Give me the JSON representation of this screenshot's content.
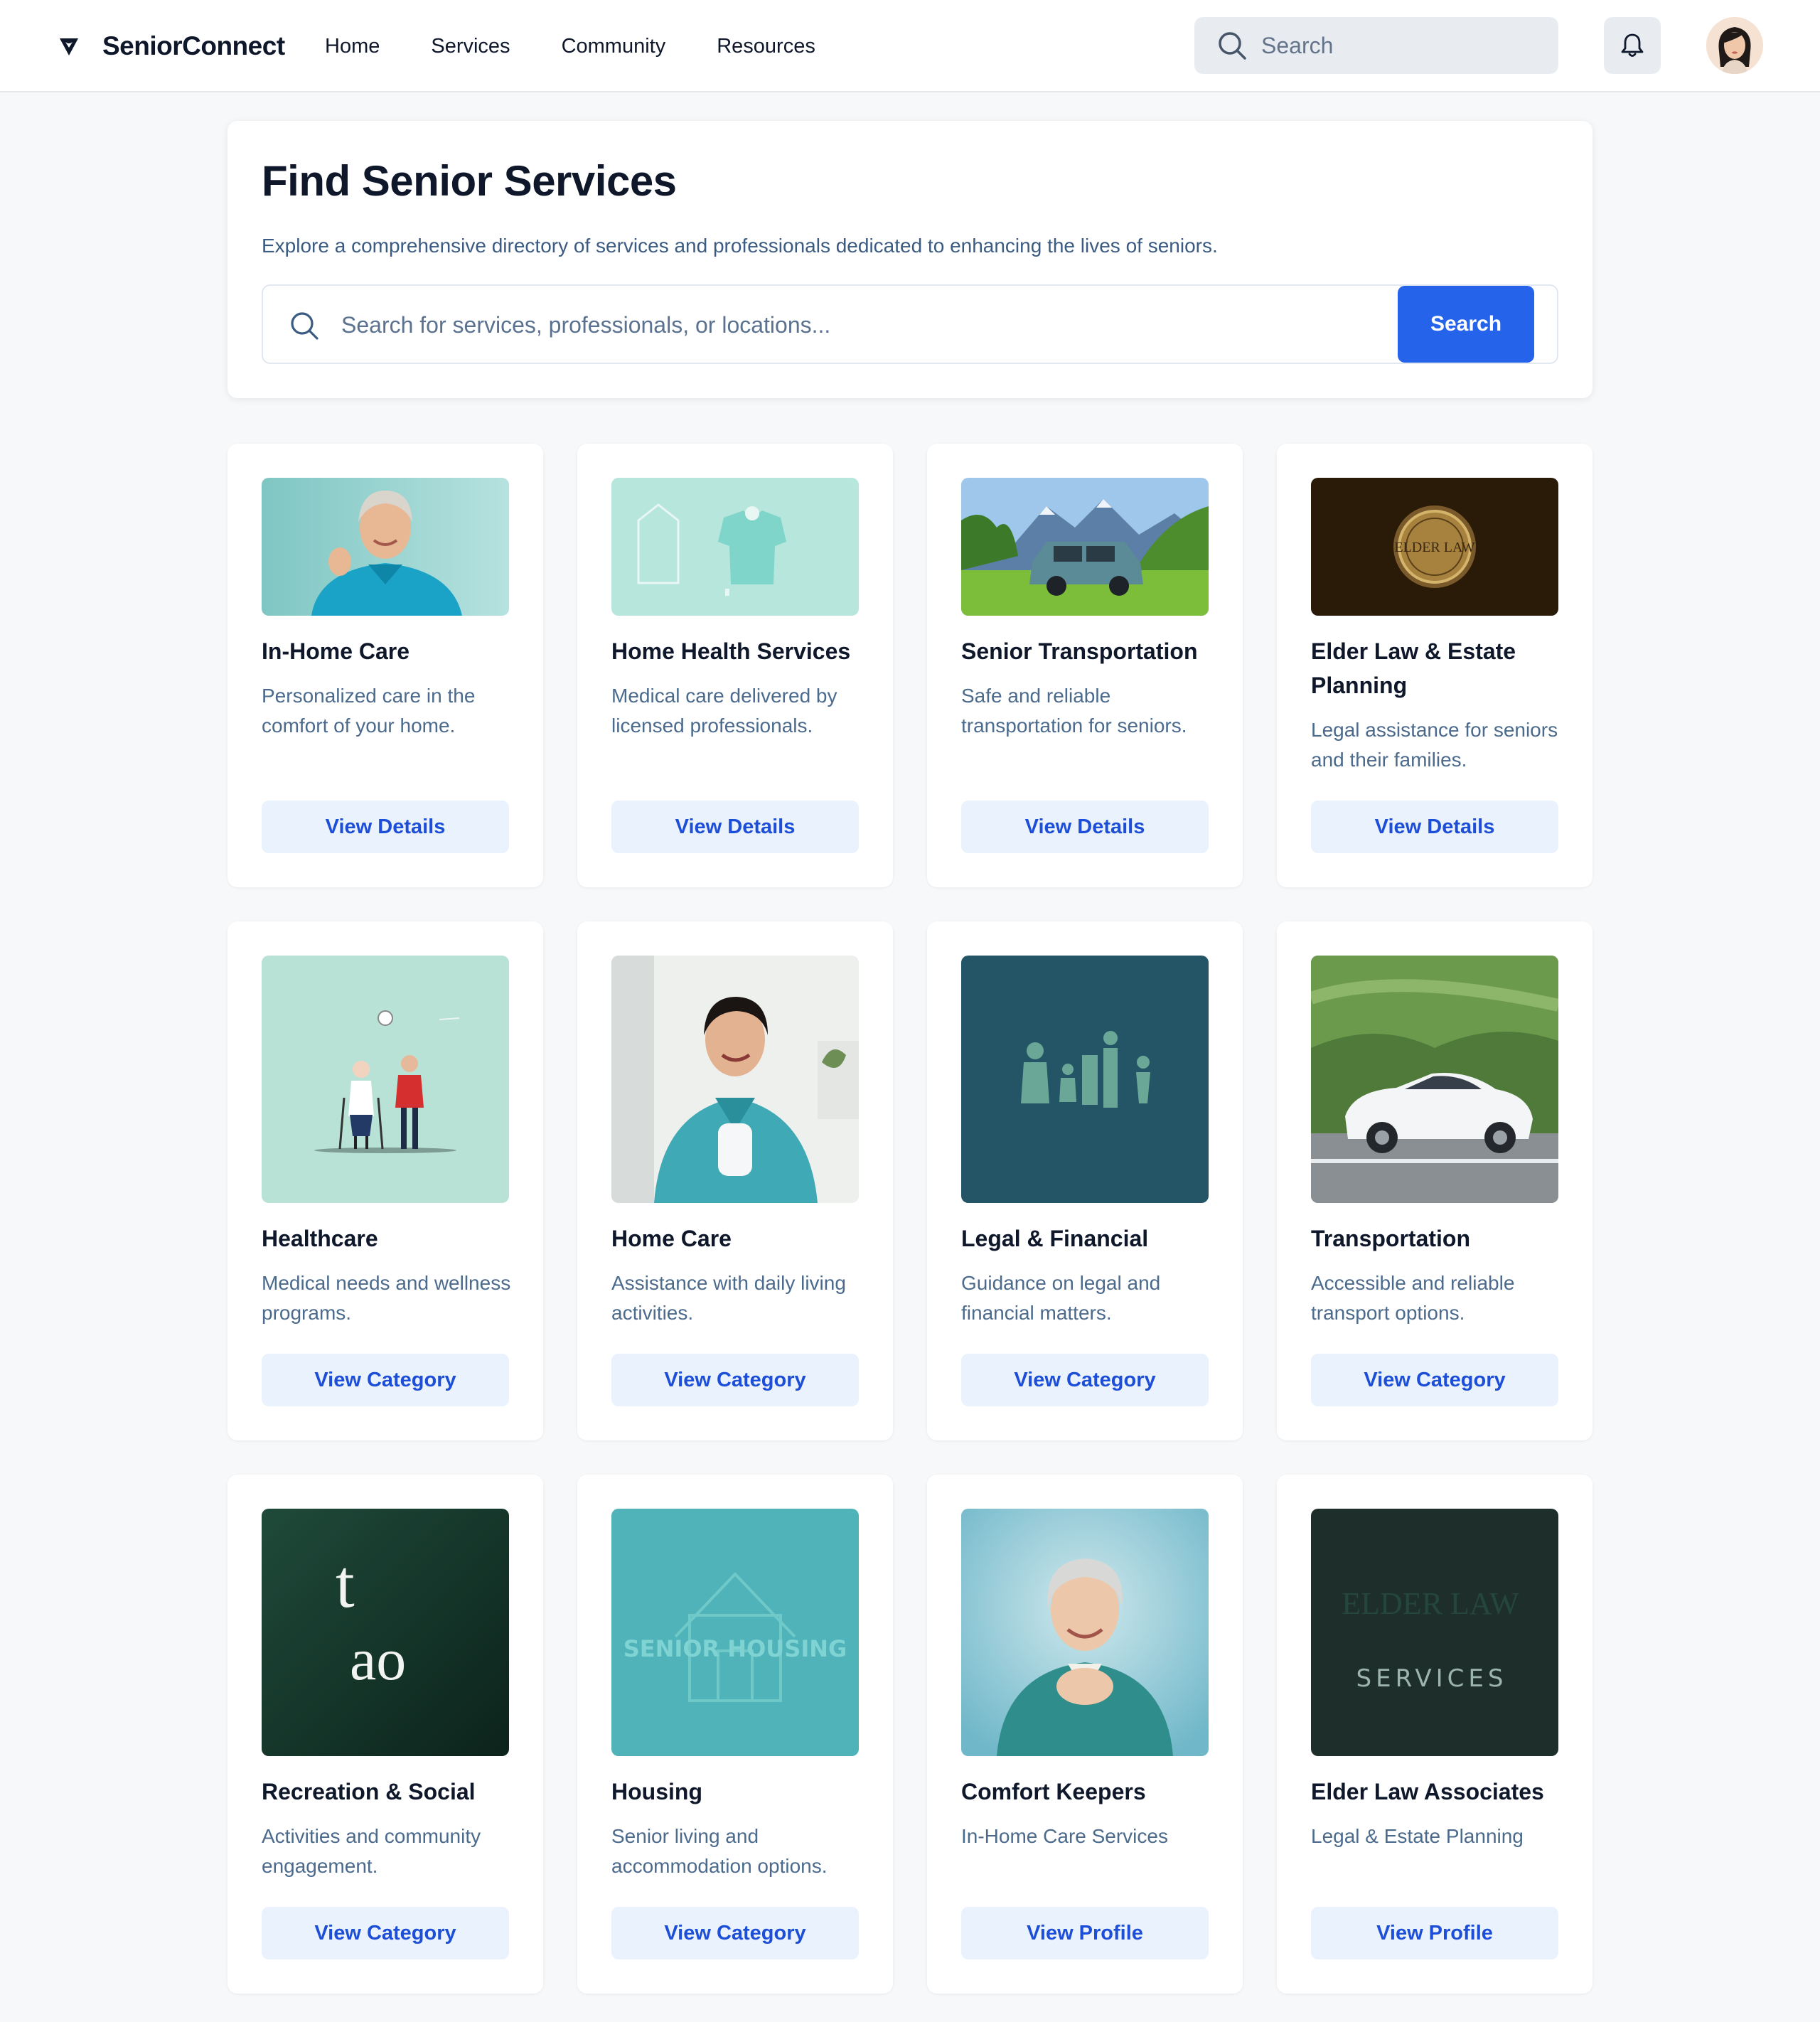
{
  "brand": {
    "name": "SeniorConnect",
    "icon": "shield-heart-icon"
  },
  "nav": [
    {
      "label": "Home"
    },
    {
      "label": "Services"
    },
    {
      "label": "Community"
    },
    {
      "label": "Resources"
    }
  ],
  "top_search": {
    "placeholder": "Search",
    "icon": "search-icon"
  },
  "notifications": {
    "icon": "bell-icon"
  },
  "hero": {
    "title": "Find Senior Services",
    "subtitle": "Explore a comprehensive directory of services and professionals dedicated to enhancing the lives of seniors.",
    "search_placeholder": "Search for services, professionals, or locations...",
    "search_button": "Search"
  },
  "services": [
    {
      "title": "In-Home Care",
      "description": "Personalized care in the comfort of your home.",
      "button": "View Details",
      "image": "senior-woman-photo"
    },
    {
      "title": "Home Health Services",
      "description": "Medical care delivered by licensed professionals.",
      "button": "View Details",
      "image": "house-and-shirt-illustration"
    },
    {
      "title": "Senior Transportation",
      "description": "Safe and reliable transportation for seniors.",
      "button": "View Details",
      "image": "minivan-mountains-photo"
    },
    {
      "title": "Elder Law & Estate Planning",
      "description": "Legal assistance for seniors and their families.",
      "button": "View Details",
      "image": "elder-law-seal",
      "seal_text": "ELDER LAW"
    }
  ],
  "categories": [
    {
      "title": "Healthcare",
      "description": "Medical needs and wellness programs.",
      "button": "View Category",
      "image": "elderly-couple-illustration"
    },
    {
      "title": "Home Care",
      "description": "Assistance with daily living activities.",
      "button": "View Category",
      "image": "caregiver-photo"
    },
    {
      "title": "Legal & Financial",
      "description": "Guidance on legal and financial matters.",
      "button": "View Category",
      "image": "family-figures-illustration"
    },
    {
      "title": "Transportation",
      "description": "Accessible and reliable transport options.",
      "button": "View Category",
      "image": "white-car-photo"
    }
  ],
  "row3": [
    {
      "title": "Recreation & Social",
      "description": "Activities and community engagement.",
      "button": "View Category",
      "image": "logo-glyphs",
      "image_text_1": "t",
      "image_text_2": "ao"
    },
    {
      "title": "Housing",
      "description": "Senior living and accommodation options.",
      "button": "View Category",
      "image": "senior-housing-logo",
      "image_text": "SENIOR HOUSING"
    },
    {
      "title": "Comfort Keepers",
      "description": "In-Home Care Services",
      "button": "View Profile",
      "image": "smiling-senior-photo"
    },
    {
      "title": "Elder Law Associates",
      "description": "Legal & Estate Planning",
      "button": "View Profile",
      "image": "elder-law-logo",
      "image_text_faded": "ELDER LAW",
      "image_text": "SERVICES"
    }
  ],
  "colors": {
    "primary": "#2563eb",
    "button_bg": "#eaf2fe",
    "button_text": "#1d4ed8",
    "muted_text": "#4b6a8c",
    "page_bg": "#f6f8fa"
  }
}
